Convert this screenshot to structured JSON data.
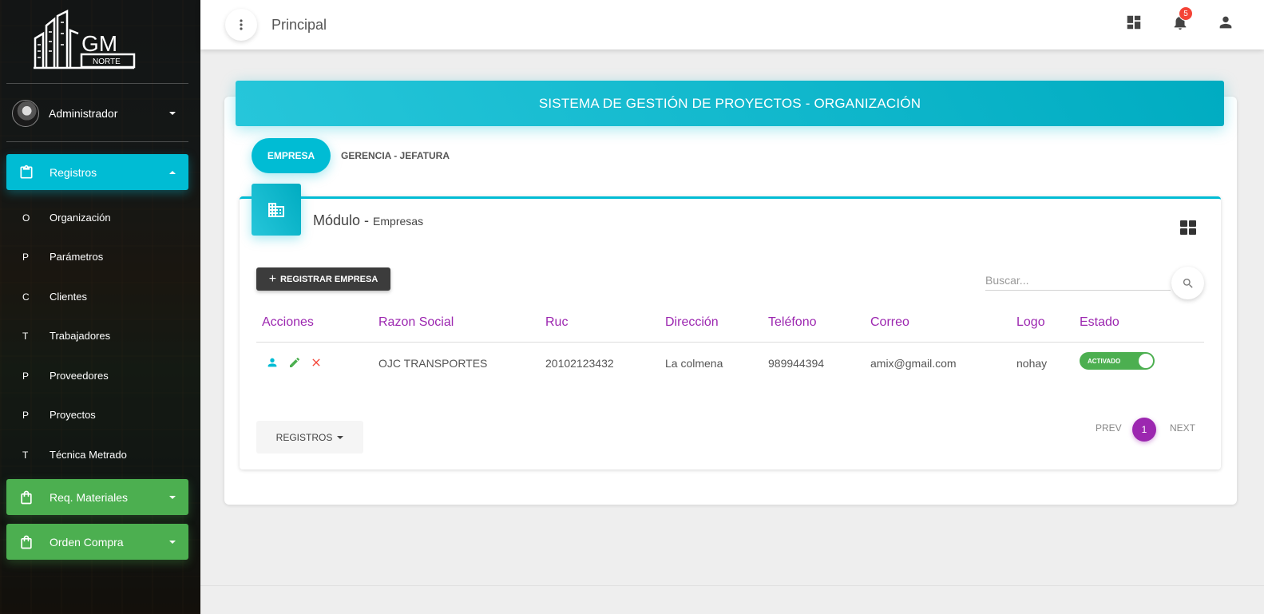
{
  "sidebar": {
    "logo_text": "GM",
    "logo_subtext": "NORTE",
    "user_name": "Administrador",
    "nav": [
      {
        "label": "Registros",
        "icon": "clipboard-icon",
        "color": "#00bcd4",
        "expanded": true
      },
      {
        "label": "Req. Materiales",
        "icon": "shopping-bag-icon",
        "color": "#4caf50",
        "expanded": false
      },
      {
        "label": "Orden Compra",
        "icon": "shopping-bag-icon",
        "color": "#4caf50",
        "expanded": false
      }
    ],
    "sub_items": [
      {
        "mini": "O",
        "label": "Organización"
      },
      {
        "mini": "P",
        "label": "Parámetros"
      },
      {
        "mini": "C",
        "label": "Clientes"
      },
      {
        "mini": "T",
        "label": "Trabajadores"
      },
      {
        "mini": "P",
        "label": "Proveedores"
      },
      {
        "mini": "P",
        "label": "Proyectos"
      },
      {
        "mini": "T",
        "label": "Técnica Metrado"
      }
    ]
  },
  "topbar": {
    "title": "Principal",
    "notifications_count": "5",
    "icons": [
      "dashboard-icon",
      "bell-icon",
      "person-icon"
    ]
  },
  "main": {
    "header_title": "SISTEMA DE GESTIÓN DE PROYECTOS - ORGANIZACIÓN",
    "tabs": [
      {
        "label": "EMPRESA",
        "active": true
      },
      {
        "label": "GERENCIA - JEFATURA",
        "active": false
      }
    ],
    "module_title": "Módulo",
    "module_sep": " - ",
    "module_subtitle": "Empresas",
    "register_button": "REGISTRAR EMPRESA",
    "search_placeholder": "Buscar...",
    "table": {
      "headers": [
        "Acciones",
        "Razon Social",
        "Ruc",
        "Dirección",
        "Teléfono",
        "Correo",
        "Logo",
        "Estado"
      ],
      "rows": [
        {
          "razon_social": "OJC TRANSPORTES",
          "ruc": "20102123432",
          "direccion": "La colmena",
          "telefono": "989944394",
          "correo": "amix@gmail.com",
          "logo": "nohay",
          "estado": "ACTIVADO",
          "estado_on": true
        }
      ]
    },
    "page_size_button": "REGISTROS",
    "pagination": {
      "prev": "PREV",
      "current": "1",
      "next": "NEXT"
    },
    "colors": {
      "accent": "#00bcd4",
      "purple": "#9c27b0",
      "green": "#4caf50",
      "danger": "#f44336"
    }
  }
}
